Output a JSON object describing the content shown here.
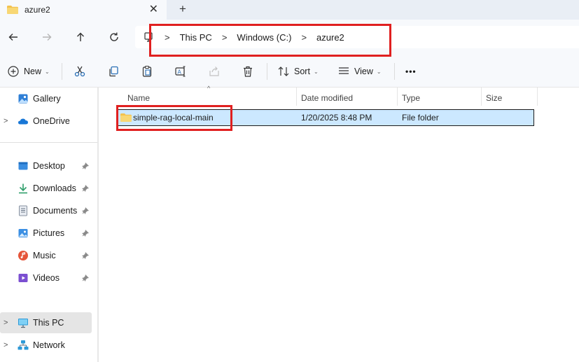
{
  "tab": {
    "title": "azure2",
    "close": "✕",
    "new_tab": "+"
  },
  "nav": {
    "back_icon": "arrow-left-icon",
    "forward_icon": "arrow-right-icon",
    "up_icon": "arrow-up-icon",
    "refresh_icon": "refresh-icon"
  },
  "breadcrumb": {
    "separator": ">",
    "items": [
      "This PC",
      "Windows (C:)",
      "azure2"
    ]
  },
  "toolbar": {
    "new_label": "New",
    "sort_label": "Sort",
    "view_label": "View",
    "more_label": "•••",
    "chevron": "⌄"
  },
  "sidebar": {
    "items": [
      {
        "label": "Gallery",
        "icon": "gallery-icon",
        "pinned": false,
        "expandable": false
      },
      {
        "label": "OneDrive",
        "icon": "cloud-icon",
        "pinned": false,
        "expandable": true
      },
      {
        "label": "Desktop",
        "icon": "desktop-icon",
        "pinned": true,
        "expandable": false
      },
      {
        "label": "Downloads",
        "icon": "download-icon",
        "pinned": true,
        "expandable": false
      },
      {
        "label": "Documents",
        "icon": "documents-icon",
        "pinned": true,
        "expandable": false
      },
      {
        "label": "Pictures",
        "icon": "pictures-icon",
        "pinned": true,
        "expandable": false
      },
      {
        "label": "Music",
        "icon": "music-icon",
        "pinned": true,
        "expandable": false
      },
      {
        "label": "Videos",
        "icon": "videos-icon",
        "pinned": true,
        "expandable": false
      },
      {
        "label": "This PC",
        "icon": "pc-icon",
        "pinned": false,
        "expandable": true
      },
      {
        "label": "Network",
        "icon": "network-icon",
        "pinned": false,
        "expandable": true
      }
    ],
    "chevron": ">"
  },
  "table": {
    "columns": [
      "Name",
      "Date modified",
      "Type",
      "Size"
    ],
    "sort_indicator": "^",
    "rows": [
      {
        "name": "simple-rag-local-main",
        "date": "1/20/2025 8:48 PM",
        "type": "File folder",
        "size": ""
      }
    ]
  },
  "colors": {
    "accent_highlight": "#e02020",
    "selection": "#cce8ff",
    "folder": "#f3c24e"
  }
}
